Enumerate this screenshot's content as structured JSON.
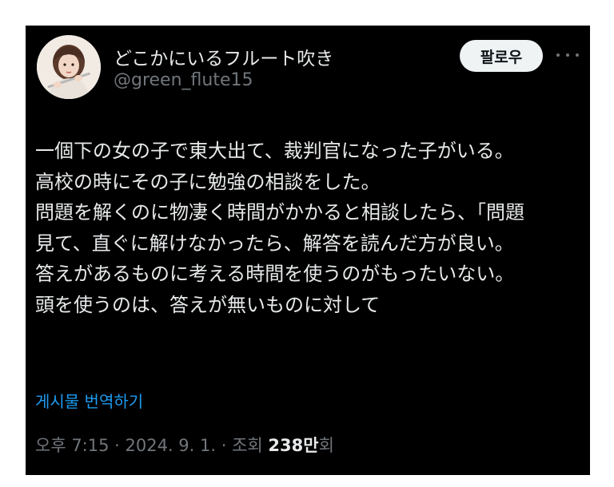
{
  "author": {
    "display_name": "どこかにいるフルート吹き",
    "handle": "@green_flute15",
    "avatar": "avatar-photo"
  },
  "follow_button": {
    "label": "팔로우"
  },
  "more_icon": "more-horizontal-icon",
  "tweet": {
    "lines": [
      "一個下の女の子で東大出て、裁判官になった子がいる。",
      "高校の時にその子に勉強の相談をした。",
      "問題を解くのに物凄く時間がかかると相談したら、｢問題",
      "見て、直ぐに解けなかったら、解答を読んだ方が良い。",
      "答えがあるものに考える時間を使うのがもったいない。",
      "頭を使うのは、答えが無いものに対して"
    ]
  },
  "translate_link": "게시물 번역하기",
  "meta": {
    "time": "오후 7:15",
    "separator": " · ",
    "date": "2024. 9. 1.",
    "views_label": "조회",
    "views_count": "238만",
    "views_suffix": "회"
  },
  "colors": {
    "background": "#000000",
    "text": "#e7e9ea",
    "muted": "#71767b",
    "link": "#1d9bf0",
    "button_bg": "#eff3f4"
  }
}
